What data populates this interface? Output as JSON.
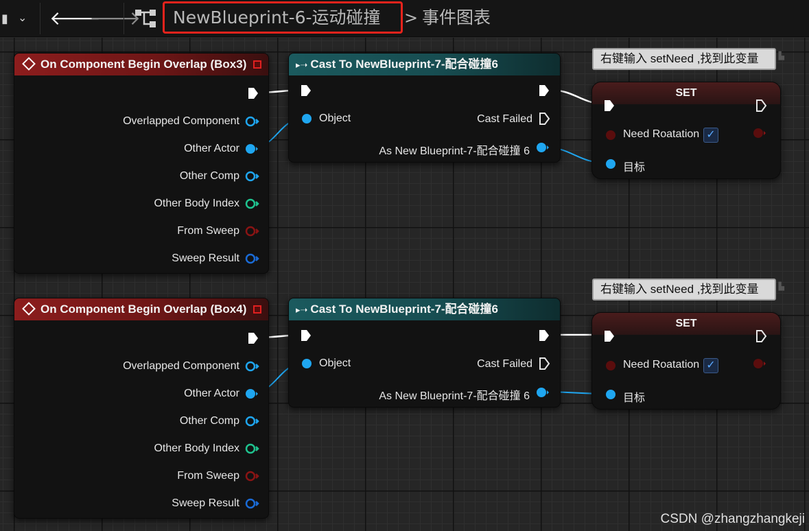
{
  "toolbar": {
    "breadcrumb_graph": "NewBlueprint-6-运动碰撞",
    "breadcrumb_separator": ">",
    "breadcrumb_page": "事件图表"
  },
  "graph": {
    "event_nodes": [
      {
        "title": "On Component Begin Overlap (Box3)",
        "pins": [
          "Overlapped Component",
          "Other Actor",
          "Other Comp",
          "Other Body Index",
          "From Sweep",
          "Sweep Result"
        ]
      },
      {
        "title": "On Component Begin Overlap (Box4)",
        "pins": [
          "Overlapped Component",
          "Other Actor",
          "Other Comp",
          "Other Body Index",
          "From Sweep",
          "Sweep Result"
        ]
      }
    ],
    "cast_nodes": [
      {
        "title": "Cast To NewBlueprint-7-配合碰撞6",
        "object_pin": "Object",
        "cast_failed": "Cast Failed",
        "as_pin": "As New Blueprint-7-配合碰撞 6"
      },
      {
        "title": "Cast To NewBlueprint-7-配合碰撞6",
        "object_pin": "Object",
        "cast_failed": "Cast Failed",
        "as_pin": "As New Blueprint-7-配合碰撞 6"
      }
    ],
    "set_nodes": [
      {
        "title": "SET",
        "var_pin": "Need Roatation",
        "checked": true,
        "target_pin": "目标"
      },
      {
        "title": "SET",
        "var_pin": "Need Roatation",
        "checked": true,
        "target_pin": "目标"
      }
    ],
    "comments": [
      "右键输入 setNeed ,找到此变量",
      "右键输入 setNeed ,找到此变量"
    ]
  },
  "colors": {
    "exec_wire": "#ffffff",
    "object_pin": "#1fa6f0",
    "struct_pin": "#1a6bd6",
    "int_pin": "#1fc38f",
    "bool_pin": "#8a1414",
    "highlight": "#e8231c"
  },
  "watermark": "CSDN @zhangzhangkeji"
}
